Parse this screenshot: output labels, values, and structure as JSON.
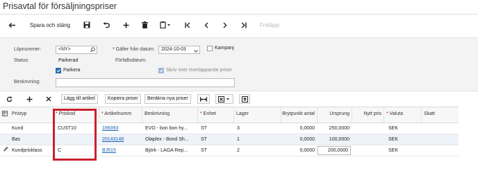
{
  "page": {
    "title": "Prisavtal för försäljningspriser"
  },
  "toolbar": {
    "save_close_label": "Spara och stäng",
    "release_label": "Frisläpp"
  },
  "form": {
    "lopnummer_label": "Löpnummer:",
    "lopnummer_value": "<NY>",
    "status_label": "Status:",
    "status_value": "Parkerad",
    "parkera_label": "Parkera",
    "parkera_checked": true,
    "beskrivning_label": "Beskrivning:",
    "beskrivning_value": "",
    "galler_label": "Gäller från datum:",
    "galler_value": "2024-10-03",
    "forfall_label": "Förfallodatum:",
    "forfall_value": "",
    "kampanj_label": "Kampanj",
    "kampanj_checked": false,
    "skriv_label": "Skriv över överlappande priser",
    "skriv_checked": true
  },
  "grid_toolbar": {
    "add_article": "Lägg till artikel",
    "copy_prices": "Kopiera priser",
    "calc_prices": "Beräkna nya priser"
  },
  "grid": {
    "headers": {
      "pristyp": "Pristyp",
      "priskod": "Priskod",
      "artikelnummer": "Artikelnumm",
      "beskrivning": "Beskrivning",
      "enhet": "Enhet",
      "lager": "Lager",
      "brytpunkt": "Brytpunkt antal",
      "ursprung": "Ursprung",
      "nytt": "Nytt pris",
      "valuta": "Valuta",
      "skatt": "Skatt"
    },
    "rows": [
      {
        "pristyp": "Kund",
        "priskod": "CUST10",
        "artikel": "199393",
        "beskrivning": "EVO - bon bon hy...",
        "enhet": "ST",
        "lager": "3",
        "brytpunkt": "0,0000",
        "ursprung": "250,0000",
        "nytt": "",
        "valuta": "SEK",
        "skatt": ""
      },
      {
        "pristyp": "Bas",
        "priskod": "",
        "artikel": "20143148",
        "beskrivning": "Olaplex - Bond Sh...",
        "enhet": "ST",
        "lager": "1",
        "brytpunkt": "0,0000",
        "ursprung": "100,0000",
        "nytt": "",
        "valuta": "SEK",
        "skatt": ""
      },
      {
        "pristyp": "Kundprisklass",
        "priskod": "C",
        "artikel": "BJ515",
        "beskrivning": "Björk - LAGA Rep...",
        "enhet": "ST",
        "lager": "2",
        "brytpunkt": "0,0000",
        "ursprung": "200,0000",
        "nytt": "",
        "valuta": "SEK",
        "skatt": ""
      }
    ]
  },
  "colors": {
    "highlight": "#c9202e",
    "link": "#1a5fb4",
    "accent": "#2b6cb0"
  }
}
